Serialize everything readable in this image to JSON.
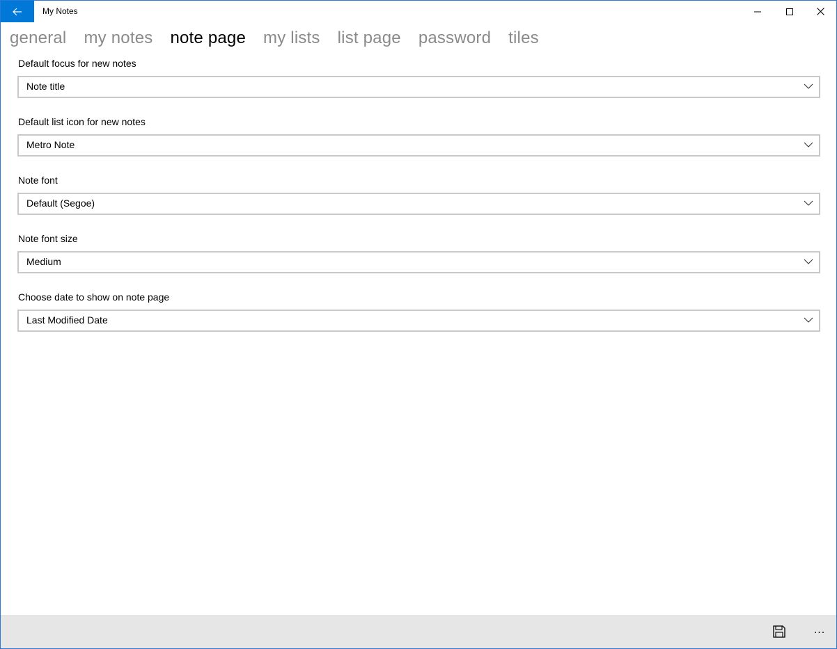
{
  "window": {
    "title": "My Notes",
    "accent_color": "#0078d7"
  },
  "titlebar": {
    "back_icon": "back-arrow-icon",
    "minimize_icon": "minimize-icon",
    "maximize_icon": "maximize-icon",
    "close_icon": "close-icon"
  },
  "tabs": [
    {
      "label": "general",
      "active": false
    },
    {
      "label": "my notes",
      "active": false
    },
    {
      "label": "note page",
      "active": true
    },
    {
      "label": "my lists",
      "active": false
    },
    {
      "label": "list page",
      "active": false
    },
    {
      "label": "password",
      "active": false
    },
    {
      "label": "tiles",
      "active": false
    }
  ],
  "settings": [
    {
      "label": "Default focus for new notes",
      "value": "Note title"
    },
    {
      "label": "Default list icon for new notes",
      "value": "Metro Note"
    },
    {
      "label": "Note font",
      "value": "Default (Segoe)"
    },
    {
      "label": "Note font size",
      "value": "Medium"
    },
    {
      "label": "Choose date to show on note page",
      "value": "Last Modified Date"
    }
  ],
  "appbar": {
    "save_icon": "save-icon",
    "more_label": "..."
  }
}
